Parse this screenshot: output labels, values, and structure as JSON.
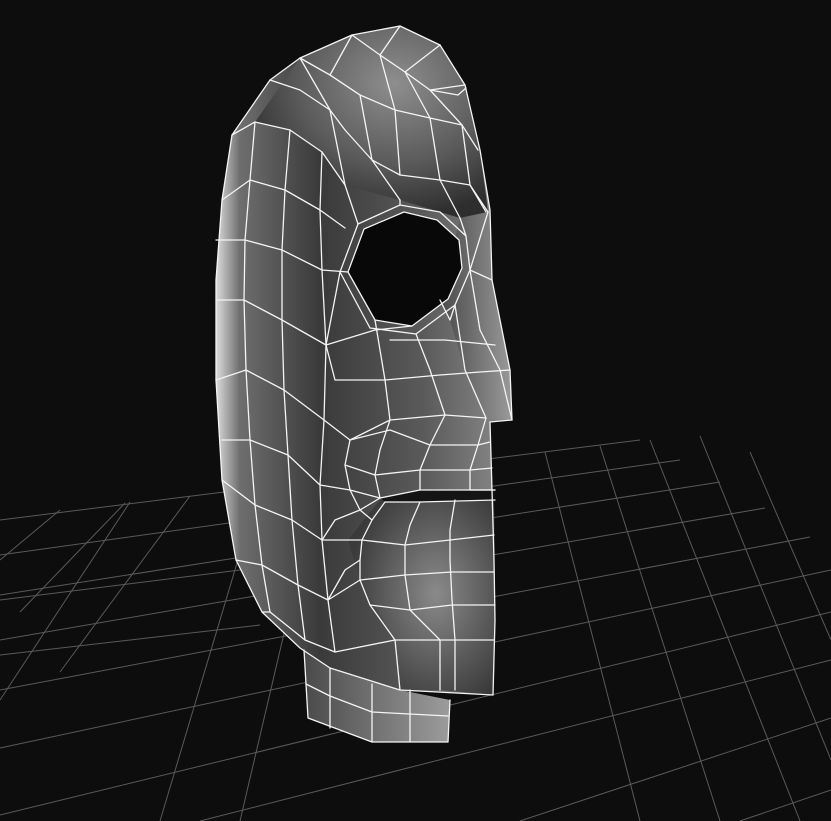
{
  "viewport": {
    "background_color": "#0d0d0d",
    "grid_color": "#5a5a5a",
    "wireframe_color": "#f4f4f4",
    "mesh_shade_light": "#8a8a8a",
    "mesh_shade_dark": "#1e1e1e",
    "object": "head-mesh"
  }
}
